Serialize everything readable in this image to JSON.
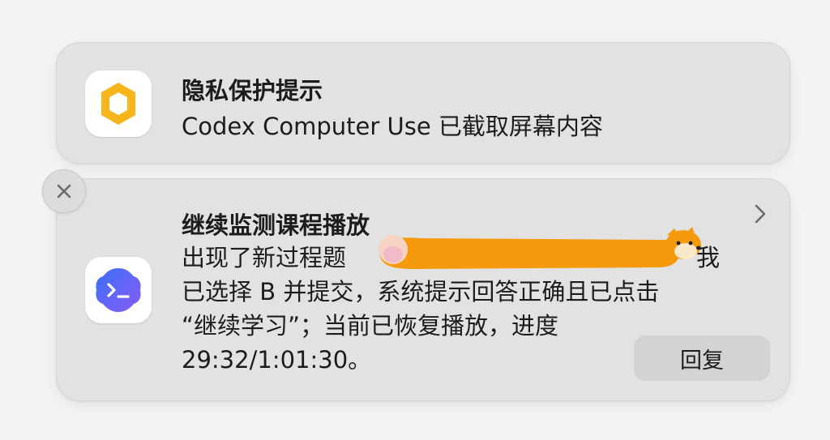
{
  "notifications": [
    {
      "title": "隐私保护提示",
      "body": "Codex Computer Use 已截取屏幕内容",
      "icon": "privacy-shield-icon",
      "icon_color": "#f6b51b"
    },
    {
      "title": "继续监测课程播放",
      "body_lines": [
        "出现了新过程题",
        "我",
        "已选择 B 并提交，系统提示回答正确且已点击",
        "“继续学习”；当前已恢复播放，进度",
        "29:32/1:01:30。"
      ],
      "icon": "codex-terminal-icon",
      "icon_colors": [
        "#3b6ff5",
        "#8a5cf6"
      ],
      "reply_label": "回复"
    }
  ],
  "close_icon": "close-icon",
  "chevron_icon": "chevron-right-icon",
  "redaction_color": "#f59a0c"
}
